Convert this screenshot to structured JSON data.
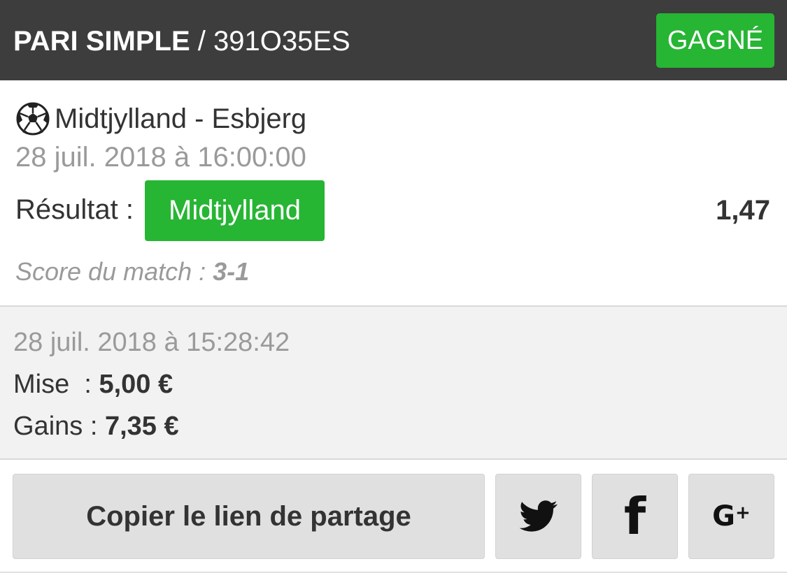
{
  "header": {
    "bet_type": "PARI SIMPLE",
    "separator": " / ",
    "bet_id": "391O35ES",
    "status": "GAGNÉ"
  },
  "event": {
    "sport_icon": "soccer-ball-icon",
    "match": "Midtjylland - Esbjerg",
    "date": "28 juil. 2018 à 16:00:00",
    "result_label": "Résultat :",
    "selection": "Midtjylland",
    "odds": "1,47",
    "score_label": "Score du match : ",
    "score": "3-1"
  },
  "summary": {
    "placed_at": "28 juil. 2018 à 15:28:42",
    "stake_label": "Mise  : ",
    "stake": "5,00 €",
    "gains_label": "Gains : ",
    "gains": "7,35 €"
  },
  "actions": {
    "copy_label": "Copier le lien de partage",
    "twitter_icon": "twitter-icon",
    "facebook_icon": "facebook-icon",
    "google_plus_icon": "google-plus-icon"
  },
  "colors": {
    "header_bg": "#3d3d3d",
    "success_green": "#27b534",
    "summary_bg": "#f2f2f2",
    "button_bg": "#e0e0e0"
  }
}
